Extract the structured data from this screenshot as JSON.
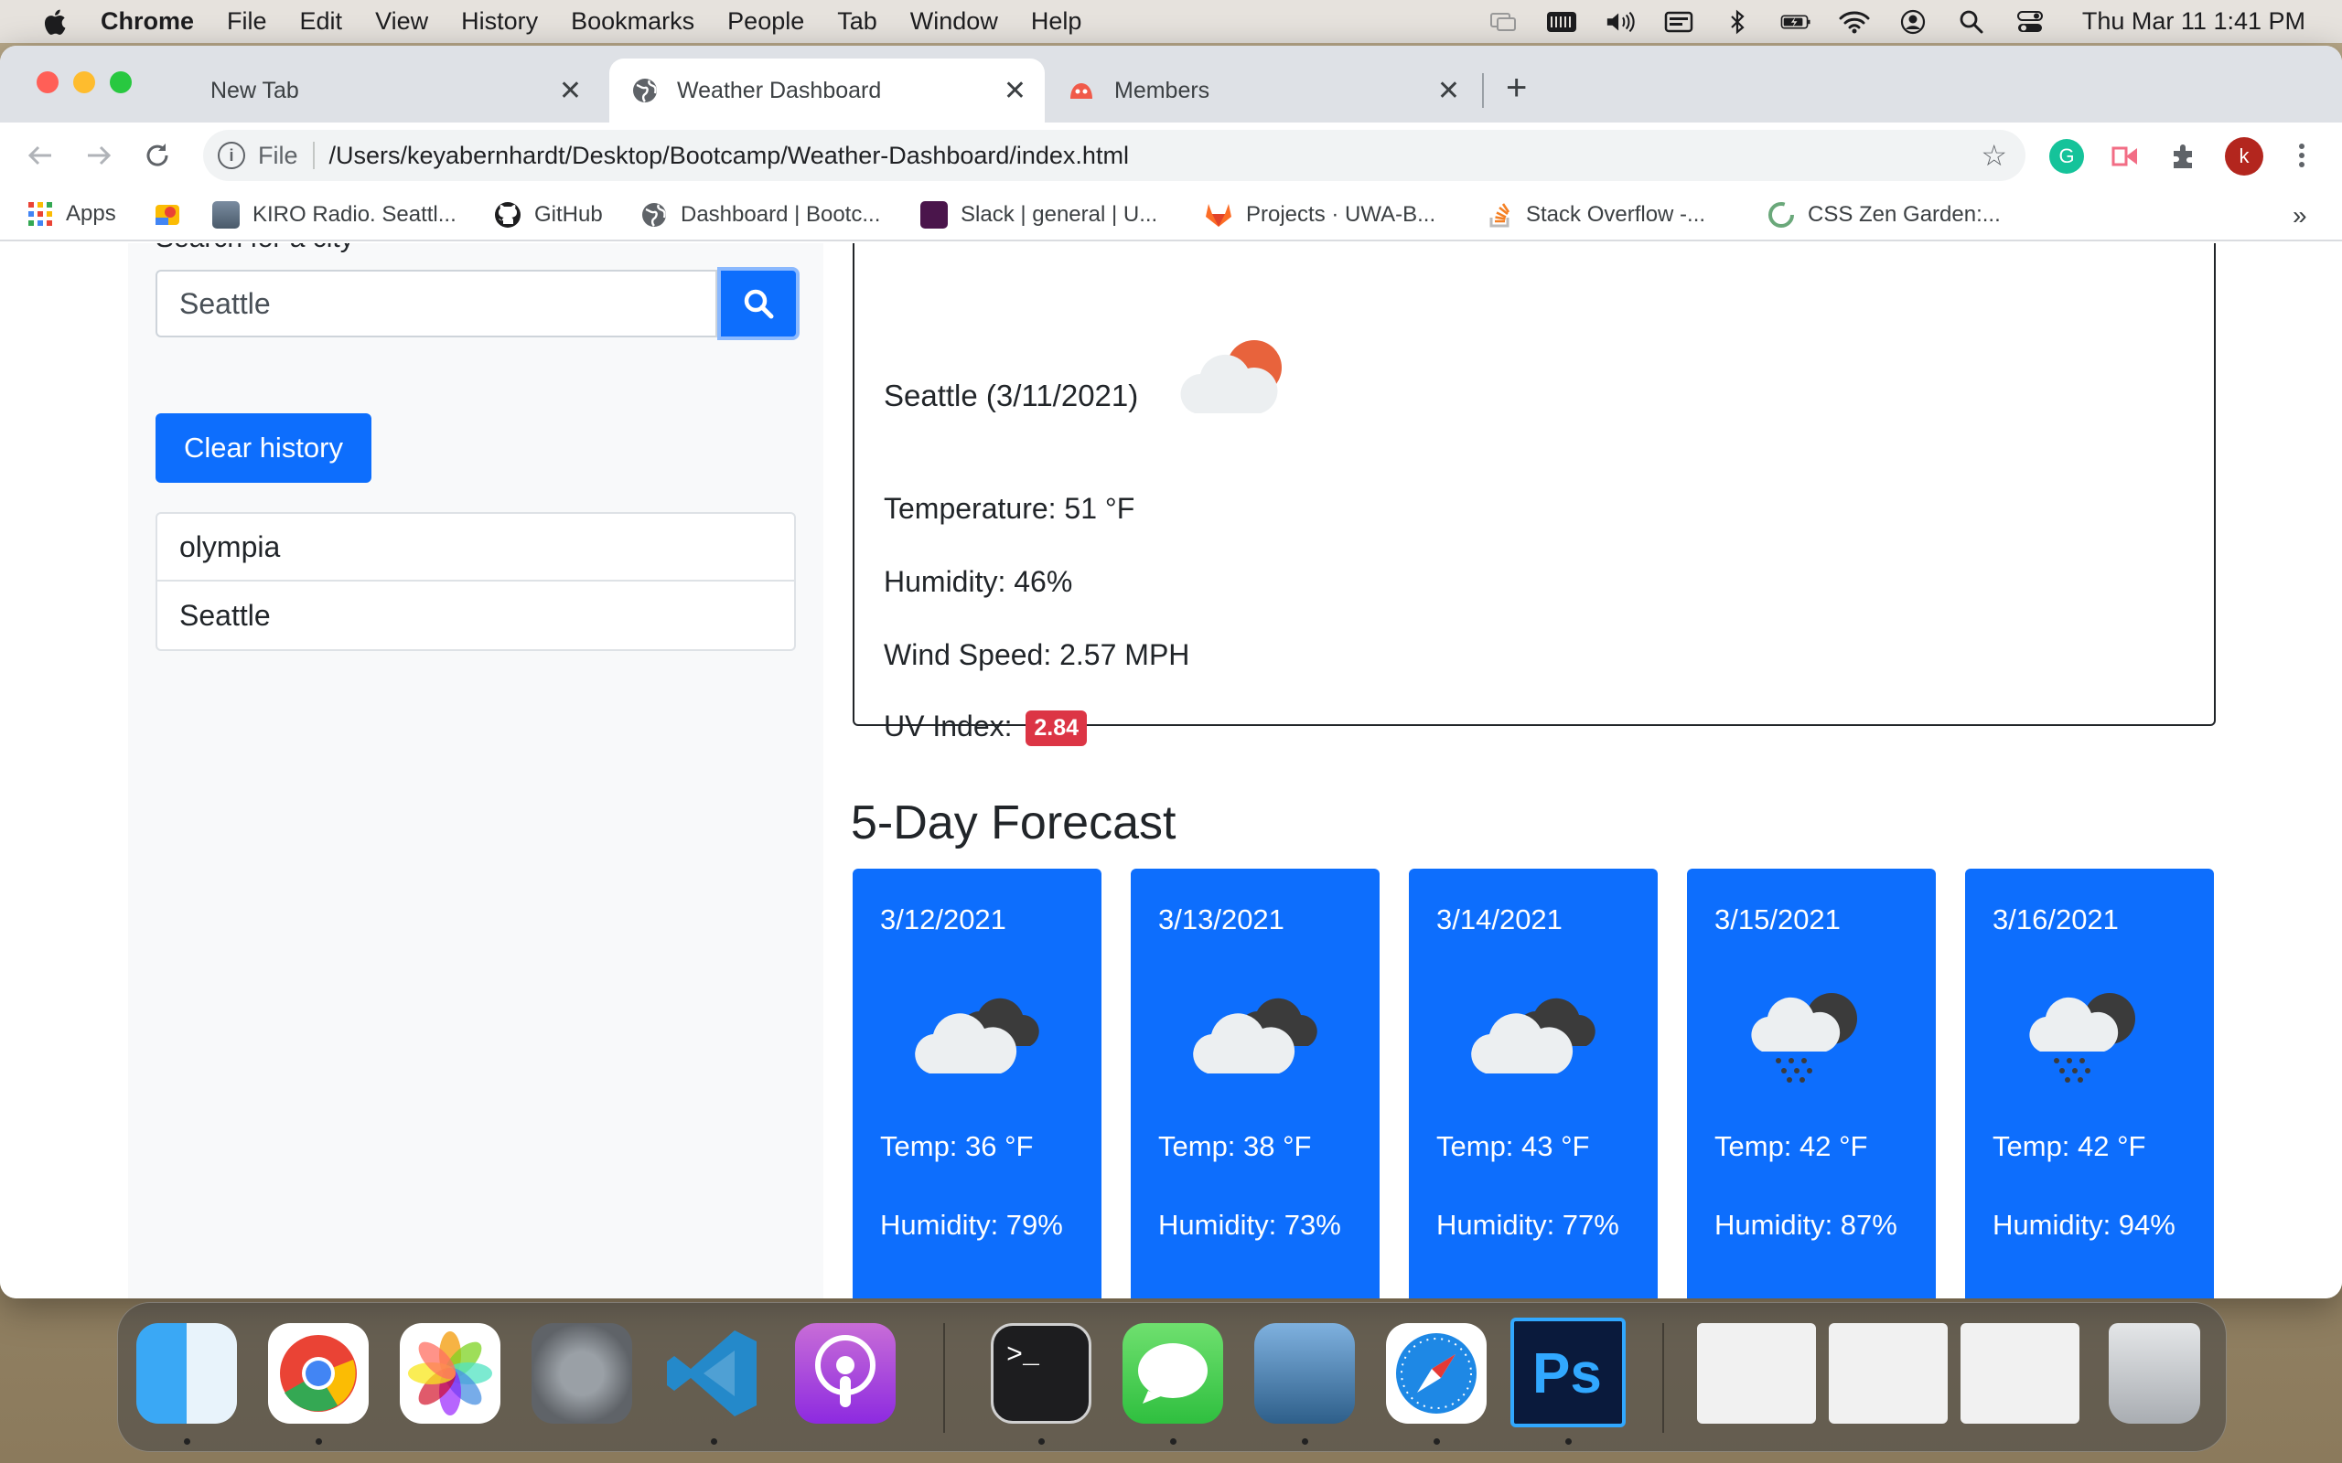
{
  "menubar": {
    "app_name": "Chrome",
    "items": [
      "File",
      "Edit",
      "View",
      "History",
      "Bookmarks",
      "People",
      "Tab",
      "Window",
      "Help"
    ],
    "clock": "Thu Mar 11  1:41 PM"
  },
  "browser": {
    "tabs": [
      {
        "title": "New Tab"
      },
      {
        "title": "Weather Dashboard"
      },
      {
        "title": "Members"
      }
    ],
    "url_scheme": "File",
    "url": "/Users/keyabernhardt/Desktop/Bootcamp/Weather-Dashboard/index.html",
    "profile_initial": "k",
    "bookmarks": [
      {
        "label": "Apps"
      },
      {
        "label": ""
      },
      {
        "label": "KIRO Radio. Seattl..."
      },
      {
        "label": "GitHub"
      },
      {
        "label": "Dashboard | Bootc..."
      },
      {
        "label": "Slack | general | U..."
      },
      {
        "label": "Projects · UWA-B..."
      },
      {
        "label": "Stack Overflow -..."
      },
      {
        "label": "CSS Zen Garden:..."
      }
    ],
    "bookmarks_overflow": "»"
  },
  "sidebar": {
    "search_label": "Search for a city",
    "search_value": "Seattle",
    "clear_label": "Clear history",
    "history": [
      "olympia",
      "Seattle"
    ]
  },
  "current": {
    "city_date": "Seattle (3/11/2021)",
    "temperature": "Temperature: 51 °F",
    "humidity": "Humidity: 46%",
    "wind": "Wind Speed: 2.57 MPH",
    "uv_label": "UV Index:",
    "uv_value": "2.84",
    "icon": "partly-cloudy-day-icon"
  },
  "forecast": {
    "title": "5-Day Forecast",
    "days": [
      {
        "date": "3/12/2021",
        "icon": "cloudy-icon",
        "temp": "Temp: 36 °F",
        "humidity": "Humidity: 79%"
      },
      {
        "date": "3/13/2021",
        "icon": "cloudy-icon",
        "temp": "Temp: 38 °F",
        "humidity": "Humidity: 73%"
      },
      {
        "date": "3/14/2021",
        "icon": "cloudy-icon",
        "temp": "Temp: 43 °F",
        "humidity": "Humidity: 77%"
      },
      {
        "date": "3/15/2021",
        "icon": "rain-icon",
        "temp": "Temp: 42 °F",
        "humidity": "Humidity: 87%"
      },
      {
        "date": "3/16/2021",
        "icon": "rain-icon",
        "temp": "Temp: 42 °F",
        "humidity": "Humidity: 94%"
      }
    ]
  },
  "colors": {
    "primary": "#0d6efd",
    "uv_badge": "#dc3545",
    "sidebar_bg": "#f8f9fa"
  },
  "dock": {
    "apps": [
      "finder-icon",
      "chrome-icon",
      "photos-icon",
      "system-preferences-icon",
      "vscode-icon",
      "podcasts-icon",
      "terminal-icon",
      "messages-icon",
      "preview-icon",
      "safari-icon",
      "photoshop-icon",
      "downloads-stack-icon",
      "screenshot-stack-icon",
      "screenshot-stack-icon",
      "trash-icon"
    ]
  }
}
